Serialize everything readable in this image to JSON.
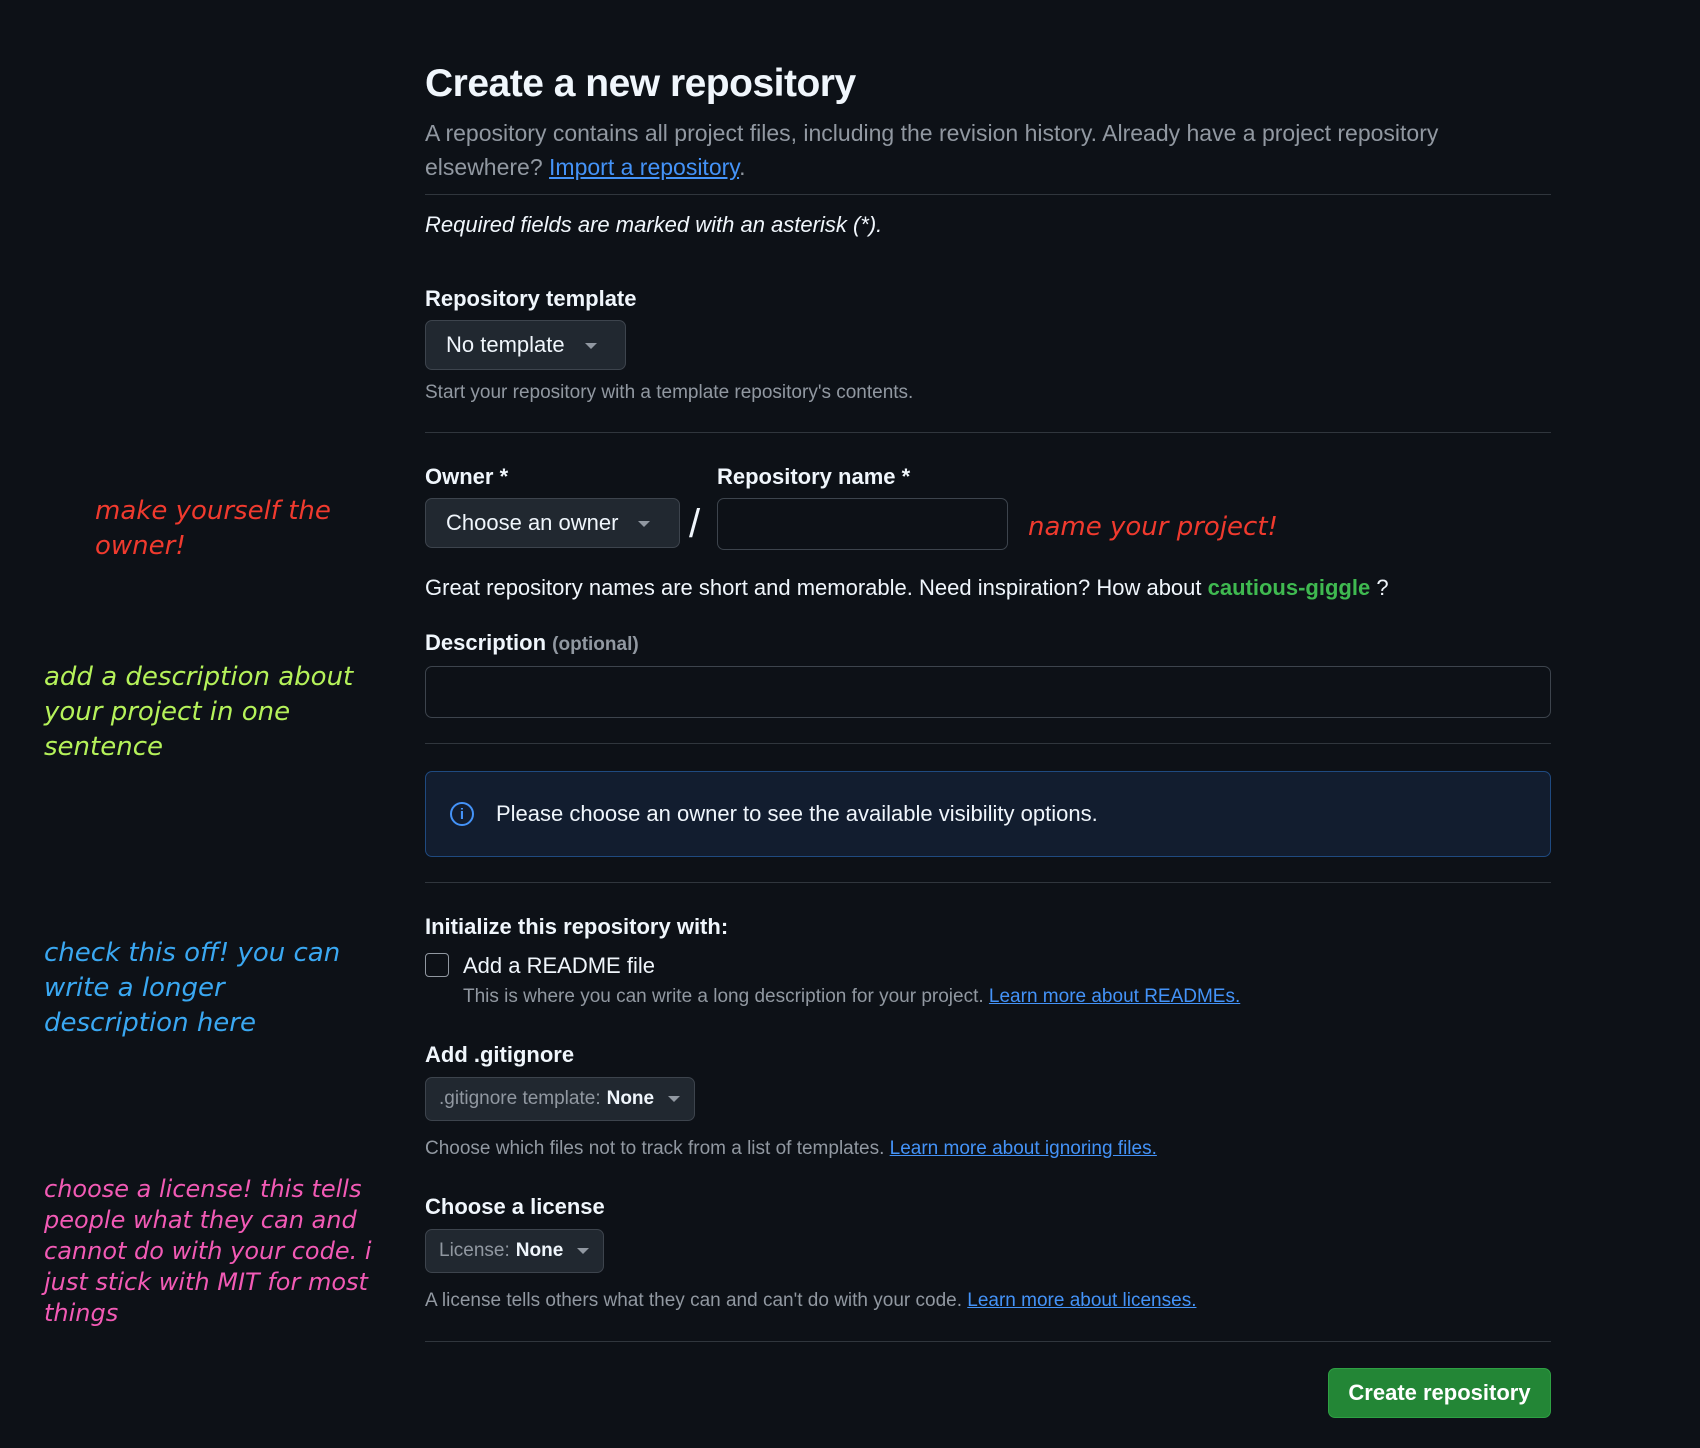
{
  "header": {
    "title": "Create a new repository",
    "subtitle": "A repository contains all project files, including the revision history. Already have a project repository elsewhere?",
    "import_link": "Import a repository",
    "subtitle_end": "."
  },
  "required_note": "Required fields are marked with an asterisk (*).",
  "template": {
    "label": "Repository template",
    "button": "No template",
    "hint": "Start your repository with a template repository's contents."
  },
  "owner": {
    "label": "Owner *",
    "button": "Choose an owner"
  },
  "separator": "/",
  "repo_name": {
    "label": "Repository name *",
    "value": "",
    "inspiration_prefix": "Great repository names are short and memorable. Need inspiration? How about",
    "suggestion": "cautious-giggle",
    "inspiration_suffix": " ?"
  },
  "description": {
    "label": "Description",
    "optional": "(optional)",
    "value": ""
  },
  "visibility_info": {
    "icon": "info-icon",
    "text": "Please choose an owner to see the available visibility options."
  },
  "initialize": {
    "heading": "Initialize this repository with:",
    "readme_label": "Add a README file",
    "readme_checked": false,
    "readme_hint": "This is where you can write a long description for your project.",
    "readme_link": "Learn more about READMEs."
  },
  "gitignore": {
    "label": "Add .gitignore",
    "button_prefix": ".gitignore template:",
    "button_value": "None",
    "hint": "Choose which files not to track from a list of templates.",
    "link": "Learn more about ignoring files."
  },
  "license": {
    "label": "Choose a license",
    "button_prefix": "License:",
    "button_value": "None",
    "hint": "A license tells others what they can and can't do with your code.",
    "link": "Learn more about licenses."
  },
  "create_button": "Create repository",
  "annotations": {
    "owner_note": "make yourself the owner!",
    "name_note": "name your project!",
    "description_note": "add a description about your project in one sentence",
    "readme_note": "check this off! you can write a longer description here",
    "license_note": "choose a license! this tells people what they can and cannot do with your code. i just stick with MIT for most things"
  },
  "colors": {
    "background": "#0d1117",
    "link": "#4493f8",
    "suggestion": "#3fb950",
    "create_button": "#238636",
    "owner_note": "#f03a2e",
    "name_note": "#f03a2e",
    "description_note": "#b5f25a",
    "readme_note": "#3aa8f2",
    "license_note": "#f25ab5"
  }
}
